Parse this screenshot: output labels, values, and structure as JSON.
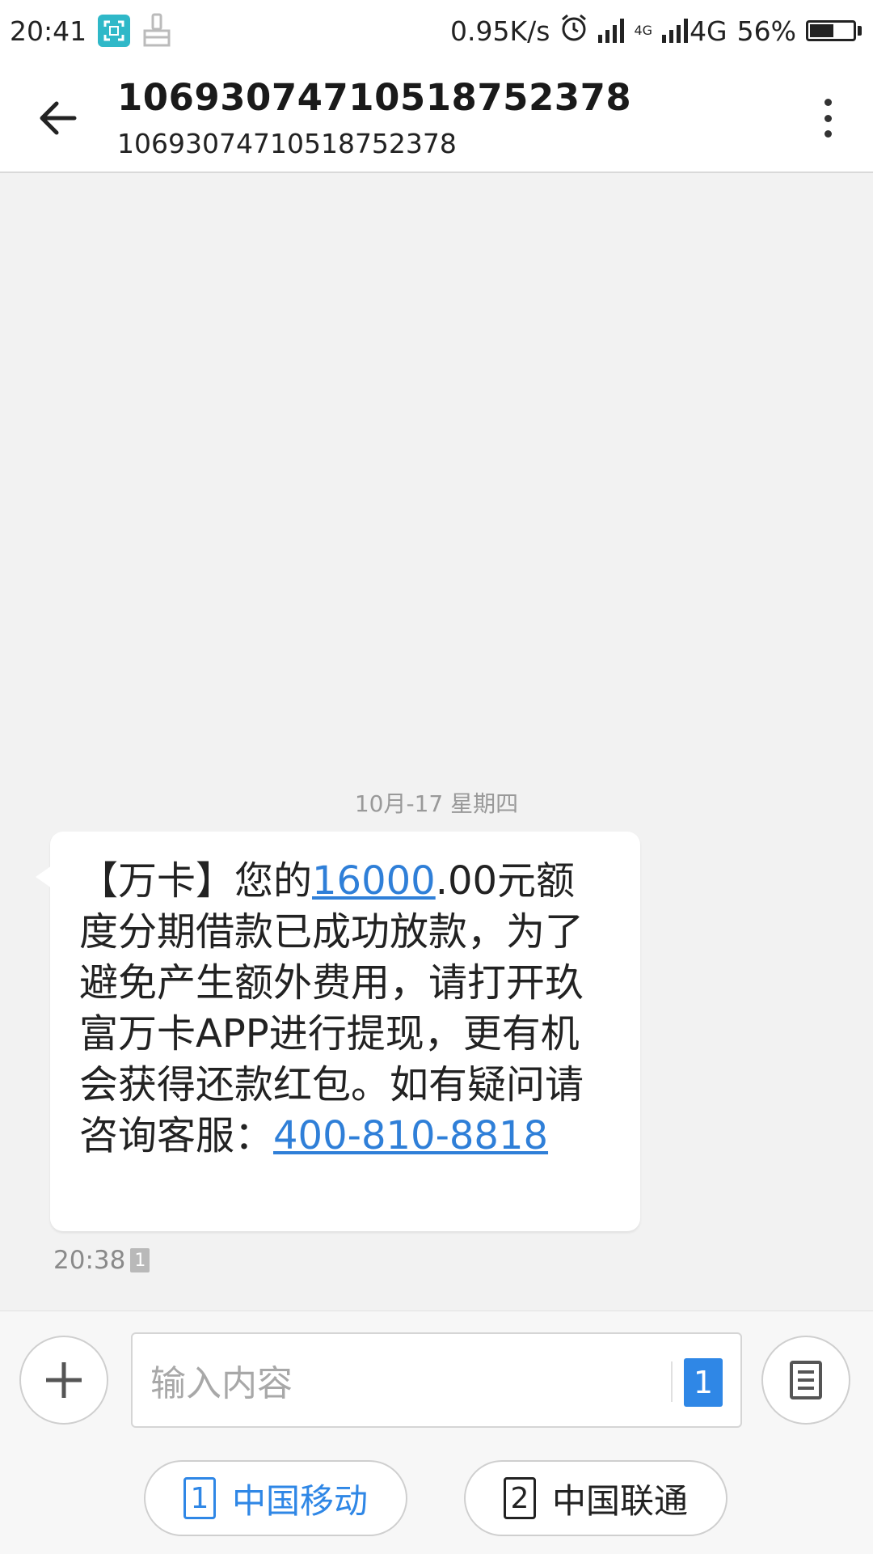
{
  "status_bar": {
    "time": "20:41",
    "net_speed": "0.95K/s",
    "network_small": "4G",
    "network": "4G",
    "battery": "56%",
    "battery_level": 0.56,
    "icons": [
      "screenshot-icon",
      "clean-icon",
      "alarm-icon",
      "signal-icon",
      "signal-4g-icon",
      "battery-icon"
    ]
  },
  "header": {
    "title": "10693074710518752378",
    "subtitle": "10693074710518752378"
  },
  "conversation": {
    "date_separator": "10月-17  星期四",
    "message": {
      "text_before_amount": "【万卡】您的",
      "amount_link": "16000",
      "text_after_amount": ".00元额度分期借款已成功放款，为了避免产生额外费用，请打开玖富万卡APP进行提现，更有机会获得还款红包。如有疑问请咨询客服：",
      "phone_link": "400-810-8818",
      "time": "20:38",
      "sim": "1"
    }
  },
  "compose": {
    "placeholder": "输入内容",
    "sim_badge": "1",
    "sim1": {
      "num": "1",
      "label": "中国移动"
    },
    "sim2": {
      "num": "2",
      "label": "中国联通"
    },
    "accent": "#2f87e6"
  }
}
